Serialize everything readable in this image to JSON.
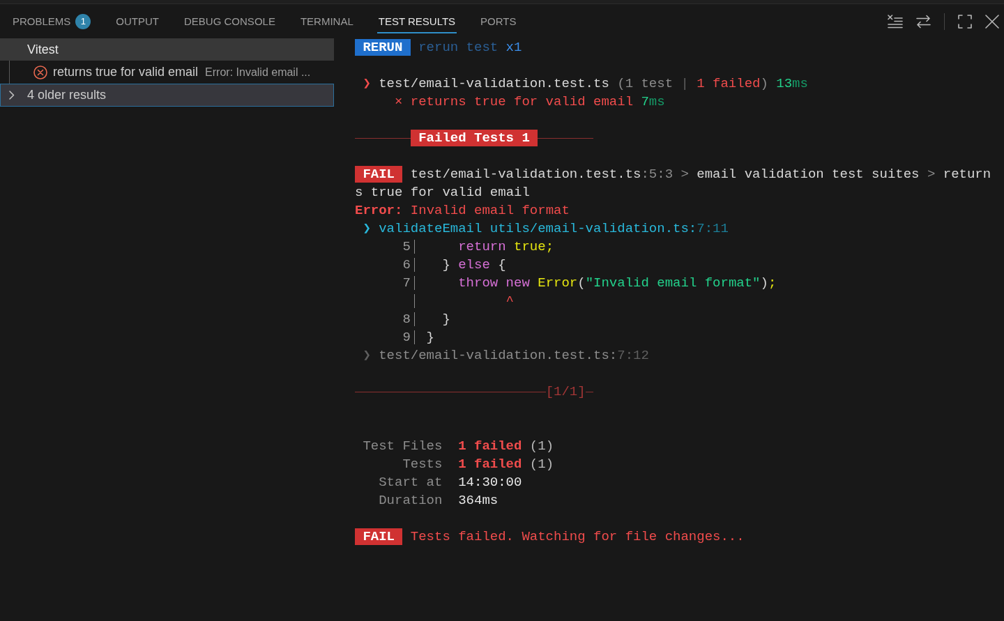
{
  "panel": {
    "tabs": [
      {
        "label": "PROBLEMS",
        "badge": "1",
        "selected": false
      },
      {
        "label": "OUTPUT",
        "selected": false
      },
      {
        "label": "DEBUG CONSOLE",
        "selected": false
      },
      {
        "label": "TERMINAL",
        "selected": false
      },
      {
        "label": "TEST RESULTS",
        "selected": true
      },
      {
        "label": "PORTS",
        "selected": false
      }
    ]
  },
  "test_tree": {
    "items": [
      {
        "kind": "group",
        "label": "Vitest",
        "selected": false,
        "expanded": true,
        "children": [
          {
            "label": "returns true for valid email",
            "message": "Error: Invalid email ...",
            "failed": true,
            "selected": false
          }
        ]
      },
      {
        "kind": "history",
        "label": "4 older results",
        "selected": true,
        "expanded": false
      }
    ]
  },
  "terminal": {
    "blocks": [
      {
        "kind": "rerun",
        "badge": {
          "text": "RERUN",
          "kind": "info"
        },
        "line": [
          {
            "text": "rerun test",
            "kind": "hint"
          },
          {
            "text": " x1",
            "kind": "info"
          }
        ]
      },
      {
        "kind": "file_result",
        "marker": {
          "text": "❯",
          "kind": "error"
        },
        "line": [
          {
            "text": "test/email-validation.test.ts ",
            "kind": "plain"
          },
          {
            "text": "(1 test ",
            "kind": "muted"
          },
          {
            "text": "| ",
            "kind": "faint"
          },
          {
            "text": "1 failed",
            "kind": "error"
          },
          {
            "text": ")",
            "kind": "muted"
          },
          {
            "text": " 13",
            "kind": "pass"
          },
          {
            "text": "ms",
            "kind": "unit"
          }
        ],
        "tests": [
          {
            "marker": {
              "text": "×",
              "kind": "error"
            },
            "line": [
              {
                "text": "returns true for valid email",
                "kind": "error"
              },
              {
                "text": " 7",
                "kind": "pass"
              },
              {
                "text": "ms",
                "kind": "unit"
              }
            ]
          }
        ]
      },
      {
        "kind": "banner",
        "badge": {
          "text": "Failed Tests 1",
          "kind": "error"
        }
      },
      {
        "kind": "failure",
        "badge": {
          "text": "FAIL",
          "kind": "error"
        },
        "heading": [
          {
            "segments": [
              {
                "text": "test/email-validation.test.ts",
                "kind": "plain"
              },
              {
                "text": ":5:3",
                "kind": "muted"
              },
              {
                "text": " > ",
                "kind": "muted"
              },
              {
                "text": "email validation test suites",
                "kind": "plain"
              },
              {
                "text": " > ",
                "kind": "muted"
              },
              {
                "text": "return",
                "kind": "plain"
              }
            ]
          },
          {
            "segments": [
              {
                "text": "s true for valid email",
                "kind": "plain"
              }
            ]
          }
        ],
        "error": [
          {
            "text": "Error:",
            "kind": "alert"
          },
          {
            "text": " Invalid email format",
            "kind": "error"
          }
        ],
        "frames": [
          {
            "marker": {
              "text": "❯",
              "kind": "trace"
            },
            "line": [
              {
                "text": "validateEmail utils/email-validation.ts:",
                "kind": "trace"
              },
              {
                "text": "7:11",
                "kind": "position"
              }
            ],
            "code": [
              {
                "kind": "source",
                "number": "5",
                "segments": [
                  {
                    "text": "    return",
                    "kind": "keyword"
                  },
                  {
                    "text": " true;",
                    "kind": "literal"
                  }
                ]
              },
              {
                "kind": "source",
                "number": "6",
                "segments": [
                  {
                    "text": "  }",
                    "kind": "plain"
                  },
                  {
                    "text": " else",
                    "kind": "keyword"
                  },
                  {
                    "text": " {",
                    "kind": "plain"
                  }
                ]
              },
              {
                "kind": "source",
                "number": "7",
                "segments": [
                  {
                    "text": "    throw new",
                    "kind": "keyword"
                  },
                  {
                    "text": " Error",
                    "kind": "literal"
                  },
                  {
                    "text": "(",
                    "kind": "plain"
                  },
                  {
                    "text": "\"Invalid email format\"",
                    "kind": "string"
                  },
                  {
                    "text": ")",
                    "kind": "plain"
                  },
                  {
                    "text": ";",
                    "kind": "literal"
                  }
                ]
              },
              {
                "kind": "caret",
                "segments": [
                  {
                    "text": "          ^",
                    "kind": "error"
                  }
                ]
              },
              {
                "kind": "source",
                "number": "8",
                "segments": [
                  {
                    "text": "  }",
                    "kind": "plain"
                  }
                ]
              },
              {
                "kind": "source",
                "number": "9",
                "segments": [
                  {
                    "text": "}",
                    "kind": "plain"
                  }
                ]
              }
            ]
          },
          {
            "marker": {
              "text": "❯",
              "kind": "faint"
            },
            "line": [
              {
                "text": "test/email-validation.test.ts:",
                "kind": "muted"
              },
              {
                "text": "7:12",
                "kind": "faint"
              }
            ]
          }
        ]
      },
      {
        "kind": "divider",
        "label": {
          "text": "[1/1]",
          "kind": "error"
        }
      },
      {
        "kind": "summary",
        "rows": [
          {
            "label": "Test Files",
            "value": [
              {
                "text": "1 failed",
                "kind": "alert"
              },
              {
                "text": " (1)",
                "kind": "soft"
              }
            ]
          },
          {
            "label": "Tests",
            "value": [
              {
                "text": "1 failed",
                "kind": "alert"
              },
              {
                "text": " (1)",
                "kind": "soft"
              }
            ]
          },
          {
            "label": "Start at",
            "value": [
              {
                "text": "14:30:00",
                "kind": "bright"
              }
            ]
          },
          {
            "label": "Duration",
            "value": [
              {
                "text": "364ms",
                "kind": "bright"
              }
            ]
          }
        ]
      },
      {
        "kind": "status",
        "badge": {
          "text": "FAIL",
          "kind": "error"
        },
        "line": [
          {
            "text": "Tests failed. Watching for file changes...",
            "kind": "error"
          }
        ]
      }
    ]
  }
}
